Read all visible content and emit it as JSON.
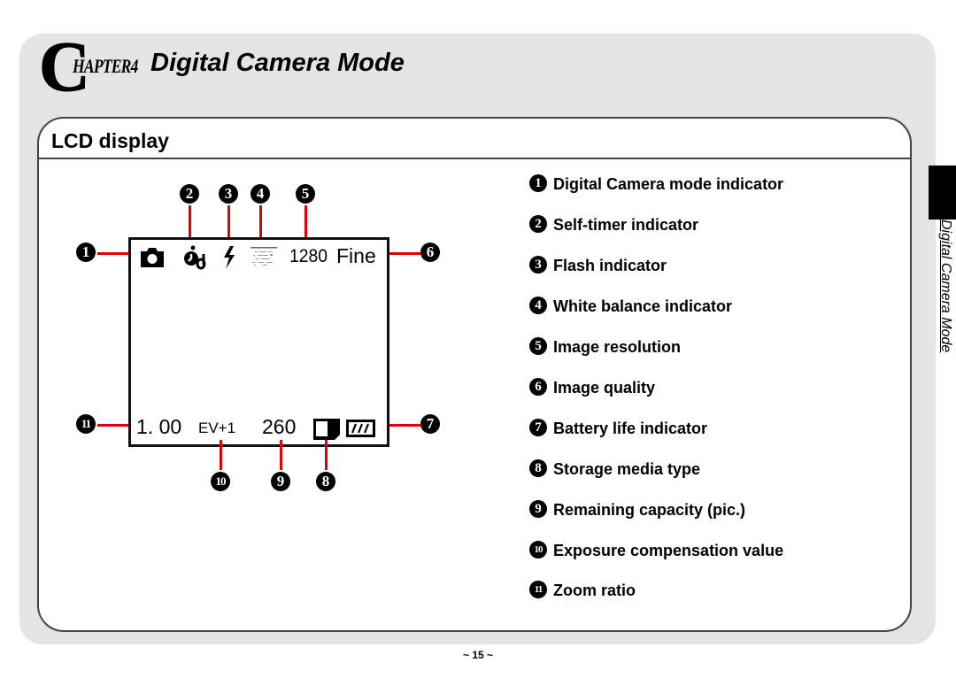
{
  "chapter": {
    "initial": "C",
    "label": "HAPTER4",
    "title": "Digital Camera Mode"
  },
  "section": {
    "title": "LCD display"
  },
  "side_tab": {
    "label": "Digital Camera Mode"
  },
  "lcd": {
    "top_row": {
      "mode_icon": "camera-icon",
      "self_timer_icon": "self-timer-icon",
      "flash_icon": "flash-icon",
      "white_balance_icon": "white-balance-icon",
      "resolution": "1280",
      "quality": "Fine"
    },
    "bottom_row": {
      "zoom_ratio": "1. 00",
      "exposure": "EV+1",
      "remaining": "260",
      "storage_icon": "sd-card-icon",
      "battery_icon": "battery-icon"
    }
  },
  "callouts": [
    "1",
    "2",
    "3",
    "4",
    "5",
    "6",
    "7",
    "8",
    "9",
    "10",
    "11"
  ],
  "legend": [
    {
      "num": "1",
      "label": "Digital Camera mode indicator"
    },
    {
      "num": "2",
      "label": "Self-timer indicator"
    },
    {
      "num": "3",
      "label": "Flash indicator"
    },
    {
      "num": "4",
      "label": "White balance indicator"
    },
    {
      "num": "5",
      "label": "Image resolution"
    },
    {
      "num": "6",
      "label": "Image quality"
    },
    {
      "num": "7",
      "label": "Battery life indicator"
    },
    {
      "num": "8",
      "label": "Storage media type"
    },
    {
      "num": "9",
      "label": "Remaining capacity (pic.)"
    },
    {
      "num": "10",
      "label": "Exposure compensation value"
    },
    {
      "num": "11",
      "label": "Zoom ratio"
    }
  ],
  "colors": {
    "callout_line": "#e00000",
    "page_background": "#e4e4e4",
    "side_tab": "#000000"
  },
  "footer": {
    "page_number": "~ 15 ~"
  }
}
